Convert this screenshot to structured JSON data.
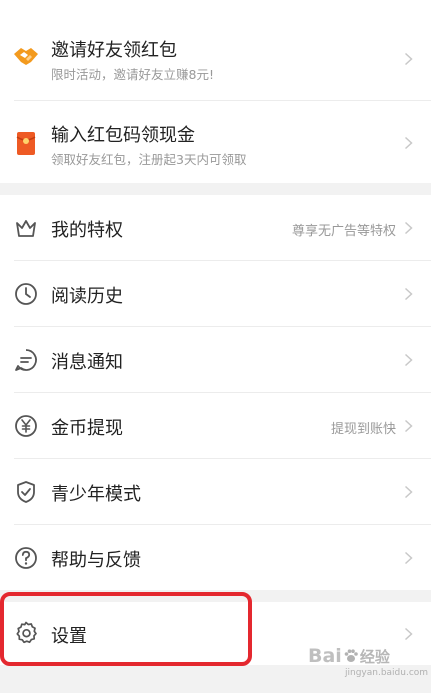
{
  "promo": {
    "invite": {
      "title": "邀请好友领红包",
      "subtitle": "限时活动，邀请好友立赚8元!"
    },
    "redpacket": {
      "title": "输入红包码领现金",
      "subtitle": "领取好友红包，注册起3天内可领取"
    }
  },
  "menu": {
    "privilege": {
      "label": "我的特权",
      "side": "尊享无广告等特权"
    },
    "history": {
      "label": "阅读历史"
    },
    "notify": {
      "label": "消息通知"
    },
    "withdraw": {
      "label": "金币提现",
      "side": "提现到账快"
    },
    "youth": {
      "label": "青少年模式"
    },
    "help": {
      "label": "帮助与反馈"
    },
    "settings": {
      "label": "设置"
    }
  },
  "watermark": {
    "brand_a": "Bai",
    "brand_b": "经验",
    "sub": "jingyan.baidu.com"
  },
  "colors": {
    "accent_orange": "#f39a1e",
    "highlight_red": "#e4282f",
    "icon_gray": "#555555"
  }
}
